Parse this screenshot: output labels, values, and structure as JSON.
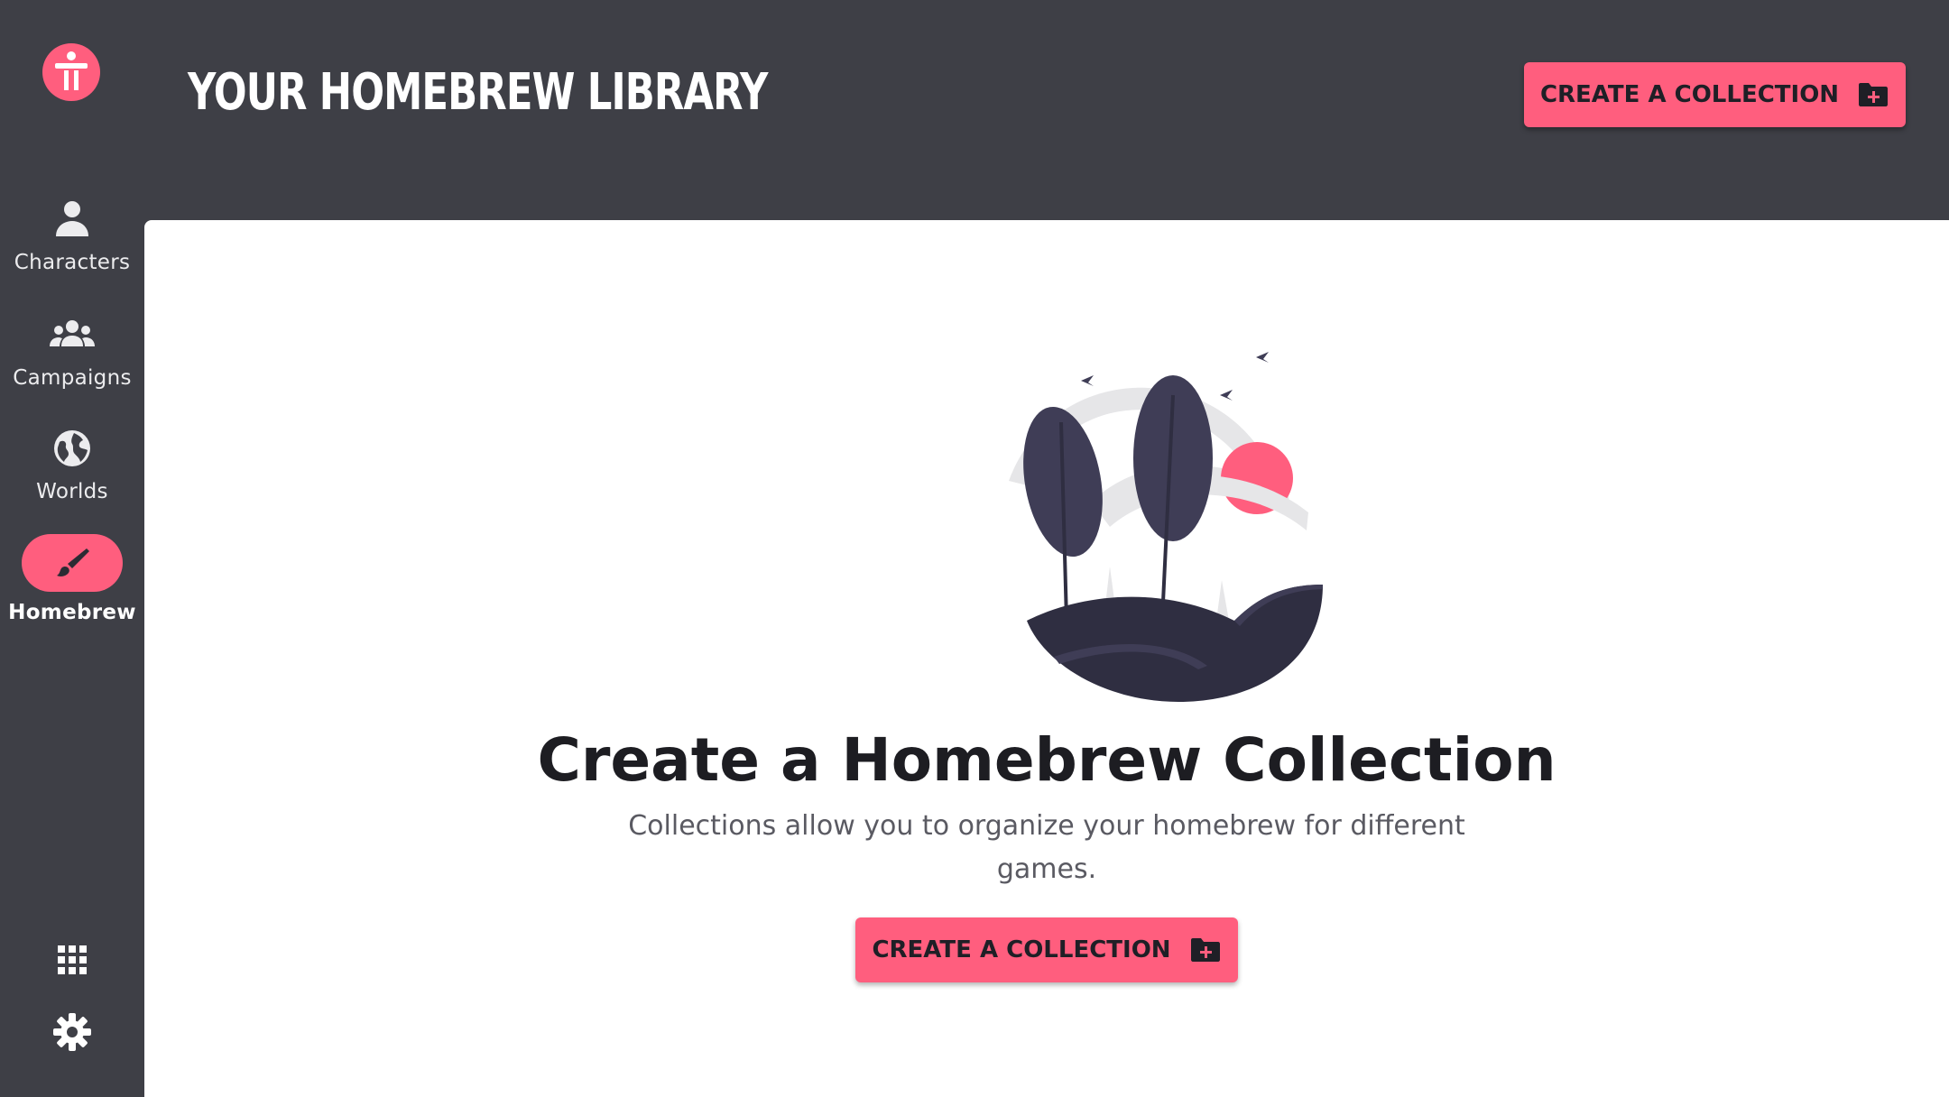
{
  "app": {
    "accent_color": "#ff5e7e",
    "sidebar_bg": "#3e3f46",
    "logo_icon": "brand-logo-icon"
  },
  "sidebar": {
    "items": [
      {
        "label": "Characters",
        "icon": "person-icon",
        "active": false
      },
      {
        "label": "Campaigns",
        "icon": "group-icon",
        "active": false
      },
      {
        "label": "Worlds",
        "icon": "globe-icon",
        "active": false
      },
      {
        "label": "Homebrew",
        "icon": "brush-icon",
        "active": true
      }
    ],
    "bottom": [
      {
        "icon": "apps-grid-icon"
      },
      {
        "icon": "gear-icon"
      }
    ]
  },
  "header": {
    "title": "YOUR HOMEBREW LIBRARY",
    "button_label": "CREATE A COLLECTION",
    "button_icon": "folder-plus-icon"
  },
  "empty_state": {
    "title": "Create a Homebrew Collection",
    "description": "Collections allow you to organize your homebrew for different games.",
    "button_label": "CREATE A COLLECTION",
    "button_icon": "folder-plus-icon"
  }
}
